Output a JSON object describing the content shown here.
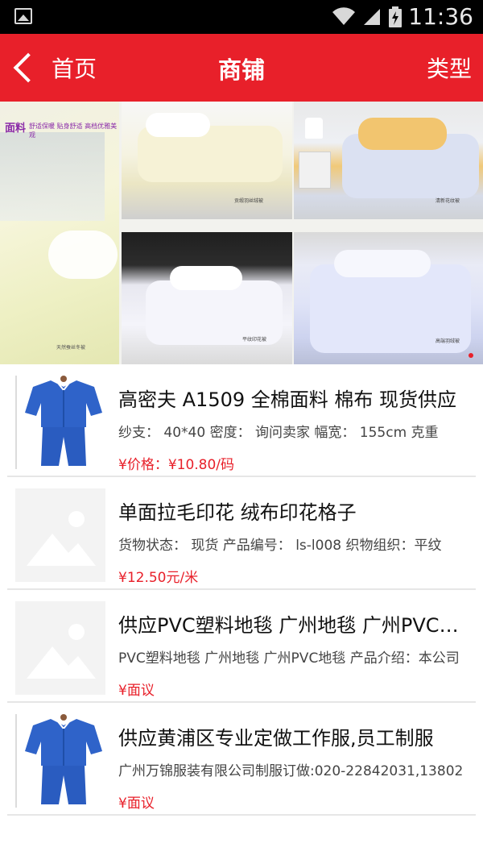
{
  "status_bar": {
    "time": "11:36",
    "icons": [
      "image-icon",
      "wifi-icon",
      "signal-icon",
      "battery-charging-icon"
    ]
  },
  "header": {
    "back_label": "首页",
    "title": "商铺",
    "right_label": "类型",
    "background_color": "#e8202a"
  },
  "banner": {
    "brand_text": "面料",
    "brand_subtext": "舒适保暖 贴身舒适 高档优雅美观",
    "captions": [
      "天然蚕丝冬被",
      "贡缎羽丝绒被",
      "清新花纹被",
      "平纹印花被",
      "高端羽绒被"
    ]
  },
  "products": [
    {
      "title": "高密夫 A1509 全棉面料 棉布 现货供应",
      "desc": "纱支： 40*40 密度： 询问卖家 幅宽： 155cm 克重",
      "price": "¥价格：¥10.80/码",
      "thumb": "workwear"
    },
    {
      "title": "单面拉毛印花 绒布印花格子",
      "desc": "货物状态： 现货  产品编号： ls-l008  织物组织：平纹",
      "price": "¥12.50元/米",
      "thumb": "placeholder"
    },
    {
      "title": "供应PVC塑料地毯 广州地毯 广州PVC地毯",
      "desc": "PVC塑料地毯 广州地毯  广州PVC地毯   产品介绍：本公司",
      "price": "¥面议",
      "thumb": "placeholder"
    },
    {
      "title": "供应黄浦区专业定做工作服,员工制服",
      "desc": "广州万锦服装有限公司制服订做:020-22842031,13802",
      "price": "¥面议",
      "thumb": "workwear"
    }
  ],
  "colors": {
    "accent": "#e8202a",
    "divider": "#e6e6e6",
    "workwear_blue": "#2f63c9"
  }
}
